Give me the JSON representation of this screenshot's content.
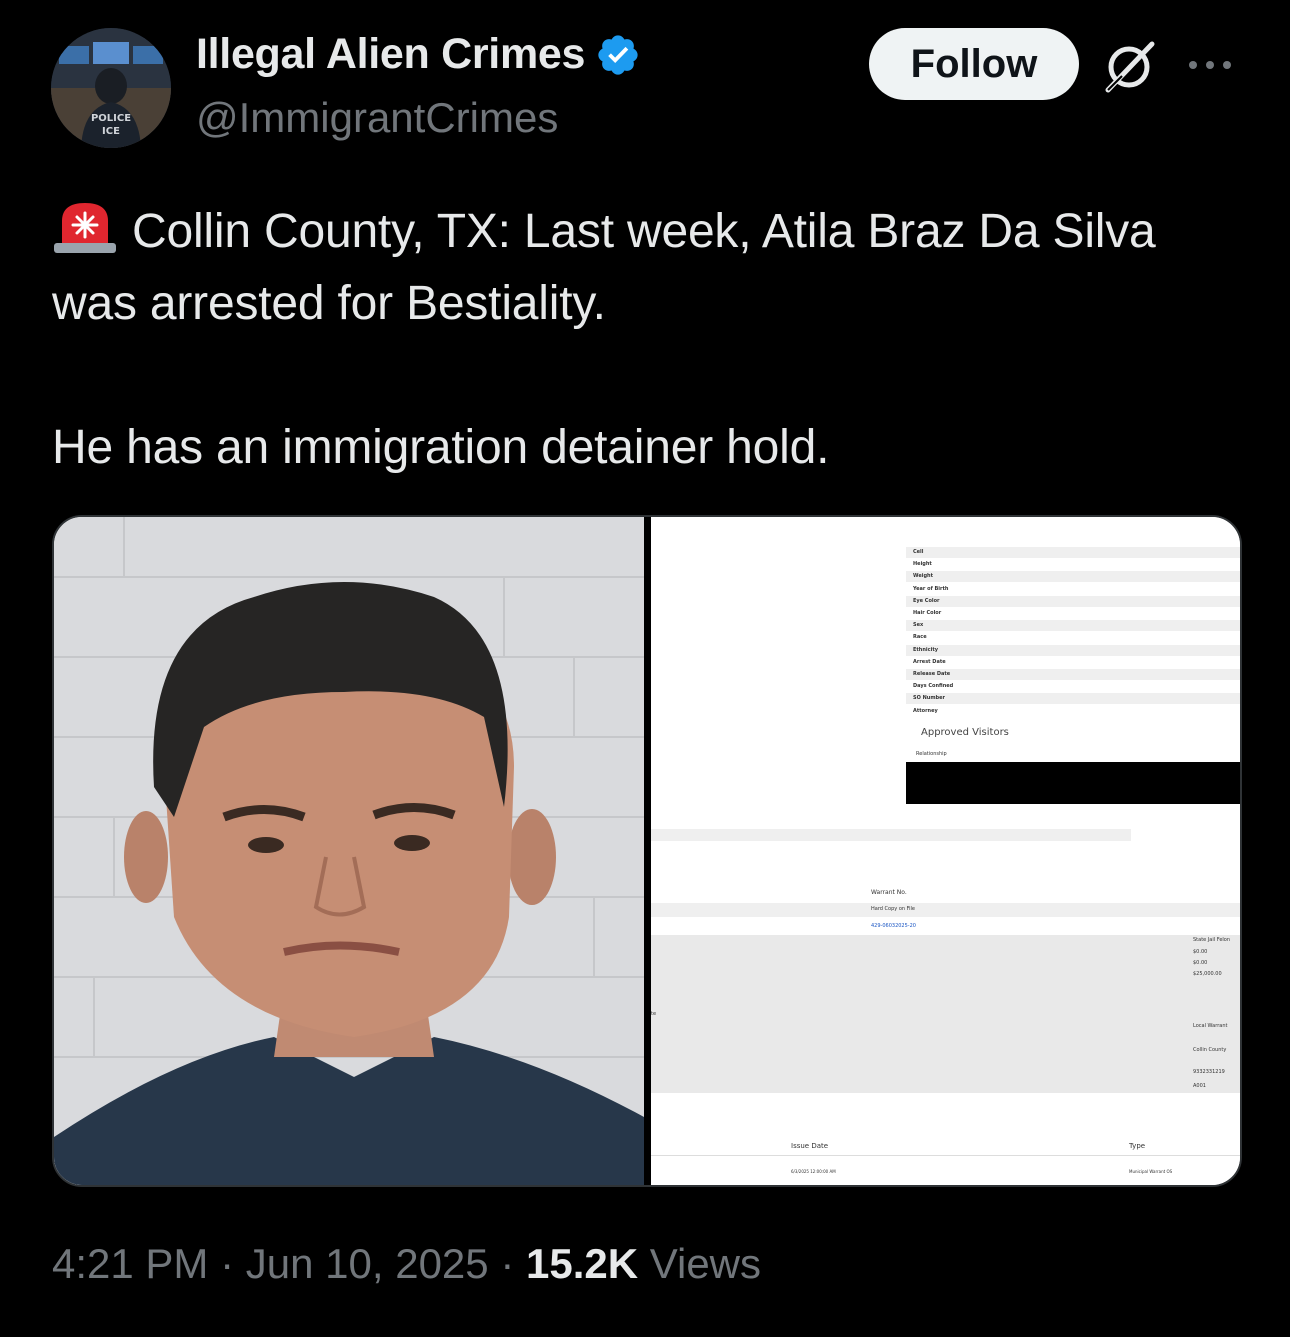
{
  "author": {
    "display_name": "Illegal Alien Crimes",
    "handle": "@ImmigrantCrimes",
    "avatar_text_line1": "POLICE",
    "avatar_text_line2": "ICE"
  },
  "actions": {
    "follow_label": "Follow",
    "grok_icon": "grok-slash-icon",
    "more_icon": "more-dots-icon"
  },
  "post": {
    "line1": "Collin County, TX: Last week, Atila Braz Da Silva was arrested for Bestiality.",
    "line2": "He has an immigration detainer hold.",
    "emoji": "police-light-icon"
  },
  "document": {
    "fields": [
      "Cell",
      "Height",
      "Weight",
      "Year of Birth",
      "Eye Color",
      "Hair Color",
      "Sex",
      "Race",
      "Ethnicity",
      "Arrest Date",
      "Release Date",
      "Days Confined",
      "SO Number",
      "Attorney"
    ],
    "approved_visitors": "Approved Visitors",
    "relationship": "Relationship",
    "warrant_no": "Warrant No.",
    "hard_copy": "Hard Copy on File",
    "warrant_number": "429-06032025-20",
    "state_jail": "State Jail Felon",
    "amounts": [
      "$0.00",
      "$0.00",
      "$25,000.00"
    ],
    "local_warrant": "Local Warrant",
    "collin_county": "Collin County",
    "id_number": "9332331219",
    "code": "A001",
    "issue_date_label": "Issue Date",
    "type_label": "Type",
    "issue_date_value": "6/3/2025 12:00:00 AM",
    "type_value": "Municipal Warrant OS",
    "left_edge": "te"
  },
  "meta": {
    "time": "4:21 PM",
    "separator": "·",
    "date": "Jun 10, 2025",
    "views_count": "15.2K",
    "views_label": "Views"
  },
  "colors": {
    "background": "#000000",
    "text": "#e7e9ea",
    "muted": "#71767b",
    "verified": "#1d9bf0",
    "follow_bg": "#eff3f4"
  }
}
